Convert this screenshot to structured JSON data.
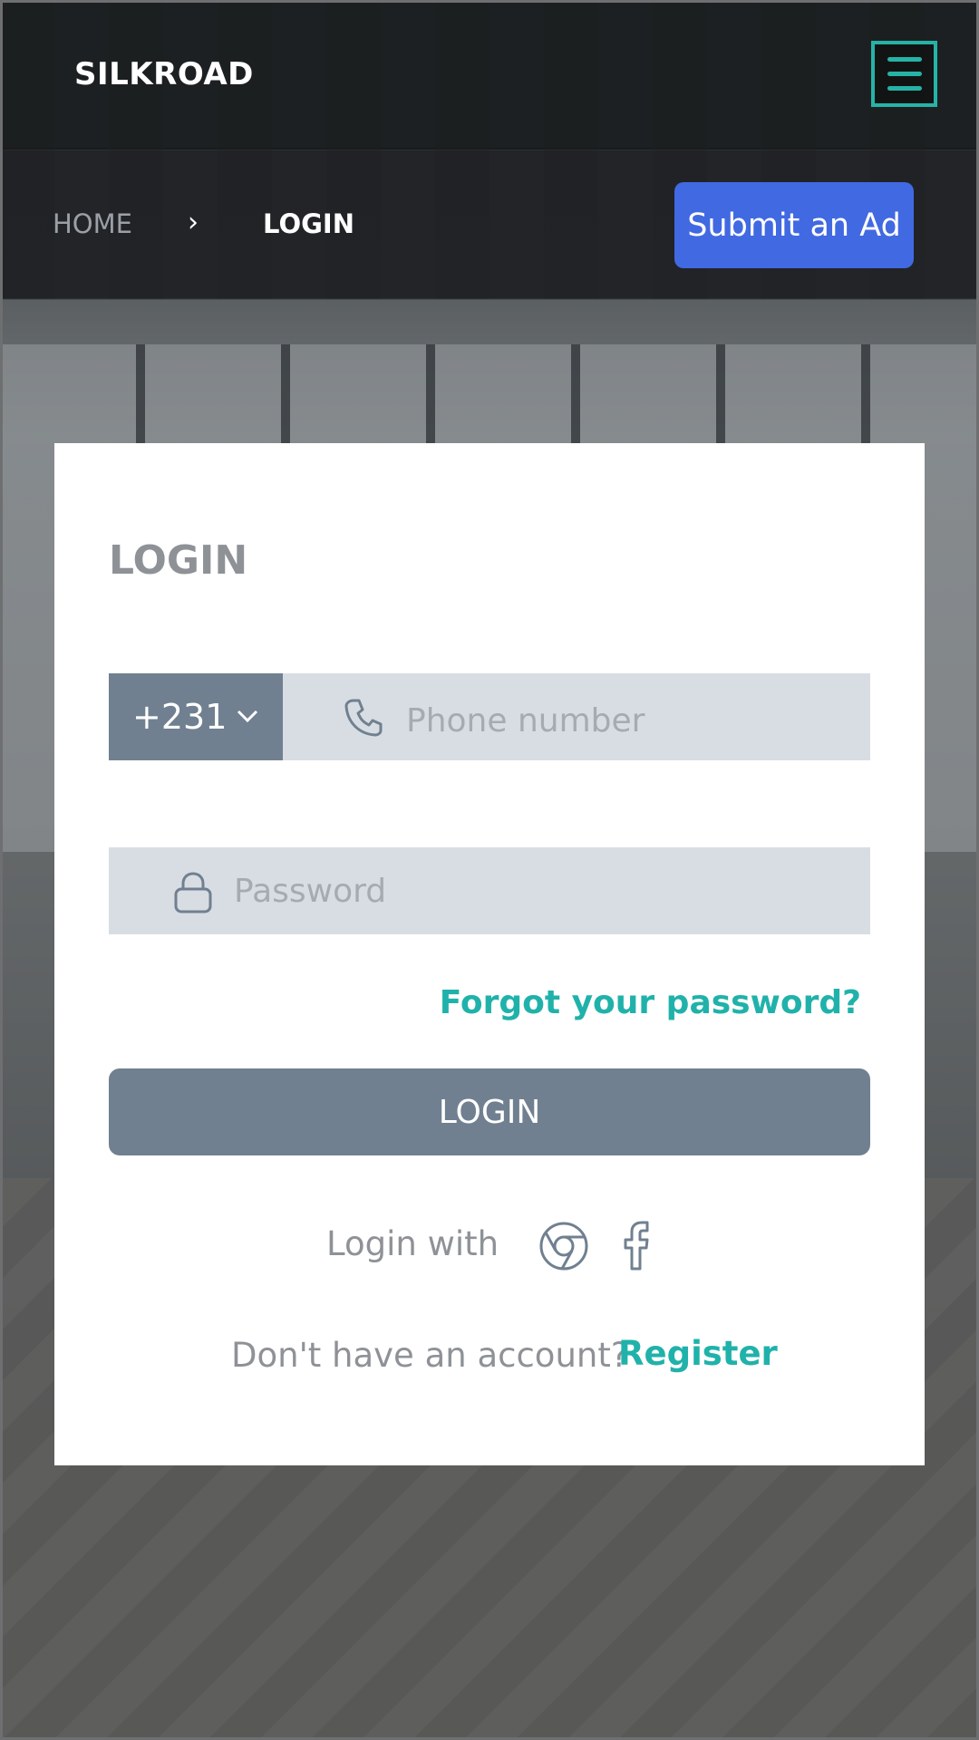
{
  "header": {
    "logo": "SILKROAD",
    "menu_icon": "hamburger-menu-icon",
    "accent_color": "#26b3a6"
  },
  "breadcrumb": {
    "home": "HOME",
    "separator": "›",
    "current": "LOGIN"
  },
  "submit_ad": {
    "label": "Submit an Ad",
    "color": "#4169e1"
  },
  "login_form": {
    "title": "LOGIN",
    "country_code": "+231",
    "phone_placeholder": "Phone number",
    "phone_icon": "phone-icon",
    "password_placeholder": "Password",
    "password_icon": "lock-icon",
    "forgot_label": "Forgot your password?",
    "submit_label": "LOGIN",
    "login_with_label": "Login with",
    "social_icons": [
      "chrome-icon",
      "facebook-icon"
    ],
    "no_account_label": "Don't have an account?",
    "register_label": "Register",
    "link_color": "#20b2aa",
    "button_color": "#708090"
  }
}
